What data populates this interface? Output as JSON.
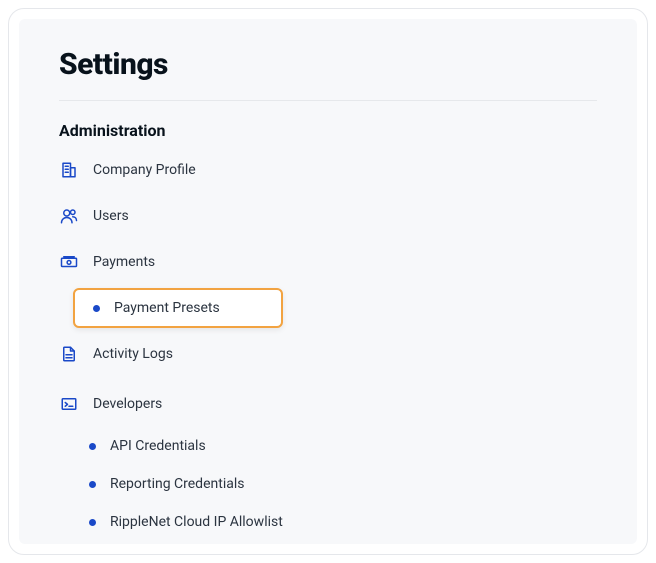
{
  "page": {
    "title": "Settings"
  },
  "section": {
    "heading": "Administration"
  },
  "nav": {
    "company_profile": {
      "label": "Company Profile"
    },
    "users": {
      "label": "Users"
    },
    "payments": {
      "label": "Payments",
      "children": {
        "payment_presets": {
          "label": "Payment Presets"
        }
      }
    },
    "activity_logs": {
      "label": "Activity Logs"
    },
    "developers": {
      "label": "Developers",
      "children": {
        "api_credentials": {
          "label": "API Credentials"
        },
        "reporting_credentials": {
          "label": "Reporting Credentials"
        },
        "ip_allowlist": {
          "label": "RippleNet Cloud IP Allowlist"
        }
      }
    }
  }
}
